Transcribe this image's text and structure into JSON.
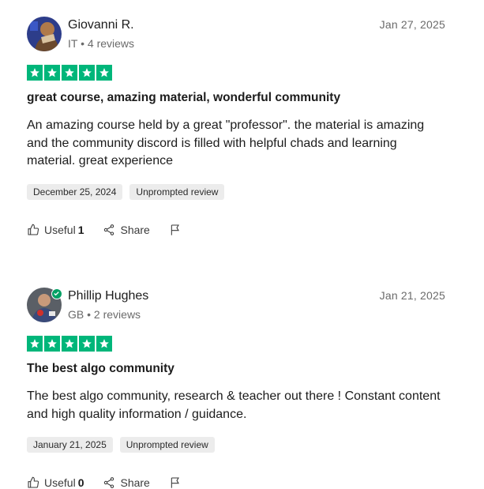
{
  "reviews": [
    {
      "name": "Giovanni R.",
      "country": "IT",
      "review_count": "4 reviews",
      "date": "Jan 27, 2025",
      "rating": 5,
      "title": "great course, amazing material, wonderful community",
      "body": "An amazing course held by a great \"professor\". the material is amazing and the community discord is filled with helpful chads and learning material. great experience",
      "experience_date": "December 25, 2024",
      "tag": "Unprompted review",
      "useful_label": "Useful",
      "useful_count": "1",
      "share_label": "Share",
      "verified": false
    },
    {
      "name": "Phillip Hughes",
      "country": "GB",
      "review_count": "2 reviews",
      "date": "Jan 21, 2025",
      "rating": 5,
      "title": "The best algo community",
      "body": "The best algo community, research & teacher out there ! Constant content and high quality information / guidance.",
      "experience_date": "January 21, 2025",
      "tag": "Unprompted review",
      "useful_label": "Useful",
      "useful_count": "0",
      "share_label": "Share",
      "verified": true
    }
  ],
  "colors": {
    "star_green": "#00b67a",
    "verified_green": "#04a064"
  },
  "icons": [
    "thumbs-up-icon",
    "share-icon",
    "flag-icon",
    "star-icon",
    "verified-check-icon"
  ]
}
